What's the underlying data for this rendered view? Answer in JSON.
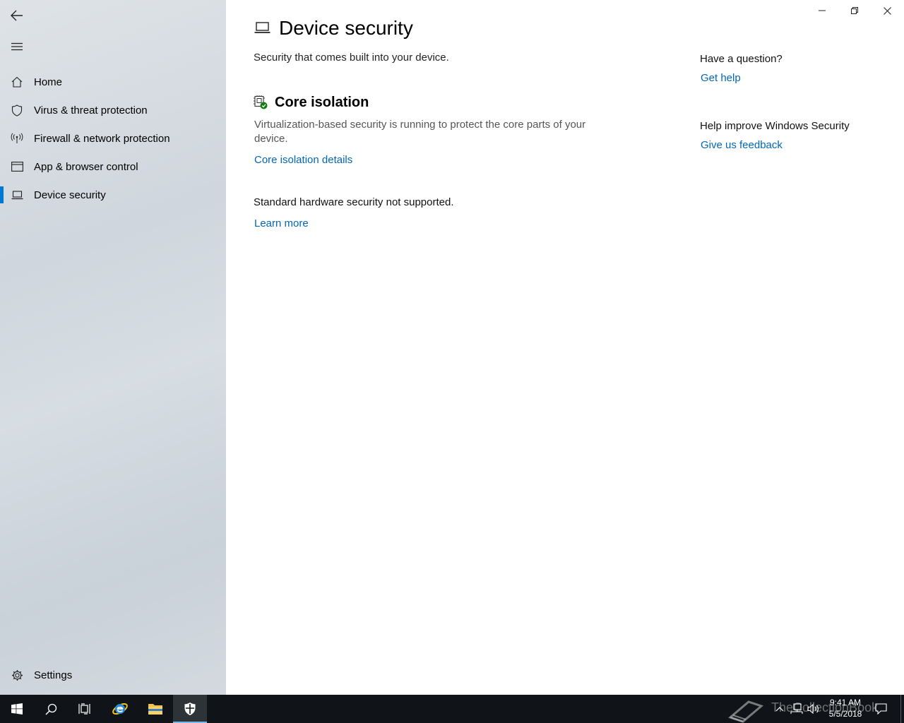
{
  "sidebar": {
    "back_icon": "back-arrow-icon",
    "menu_icon": "hamburger-icon",
    "items": [
      {
        "label": "Home",
        "icon": "home-icon"
      },
      {
        "label": "Virus & threat protection",
        "icon": "shield-icon"
      },
      {
        "label": "Firewall & network protection",
        "icon": "wifi-antenna-icon"
      },
      {
        "label": "App & browser control",
        "icon": "app-window-icon"
      },
      {
        "label": "Device security",
        "icon": "laptop-icon",
        "active": true
      }
    ],
    "settings": {
      "label": "Settings",
      "icon": "gear-icon"
    }
  },
  "window": {
    "controls": [
      "minimize",
      "restore",
      "close"
    ]
  },
  "main": {
    "title": "Device security",
    "subtitle": "Security that comes built into your device.",
    "core": {
      "title": "Core isolation",
      "description": "Virtualization-based security is running to protect the core parts of your device.",
      "link": "Core isolation details"
    },
    "hardware": {
      "text": "Standard hardware security not supported.",
      "link": "Learn more"
    }
  },
  "help": {
    "question": "Have a question?",
    "get_help": "Get help",
    "improve": "Help improve Windows Security",
    "feedback": "Give us feedback"
  },
  "taskbar": {
    "time": "9:41 AM",
    "date": "5/5/2018",
    "watermark": "TheCollectionBook",
    "accent": "#0078d7"
  }
}
